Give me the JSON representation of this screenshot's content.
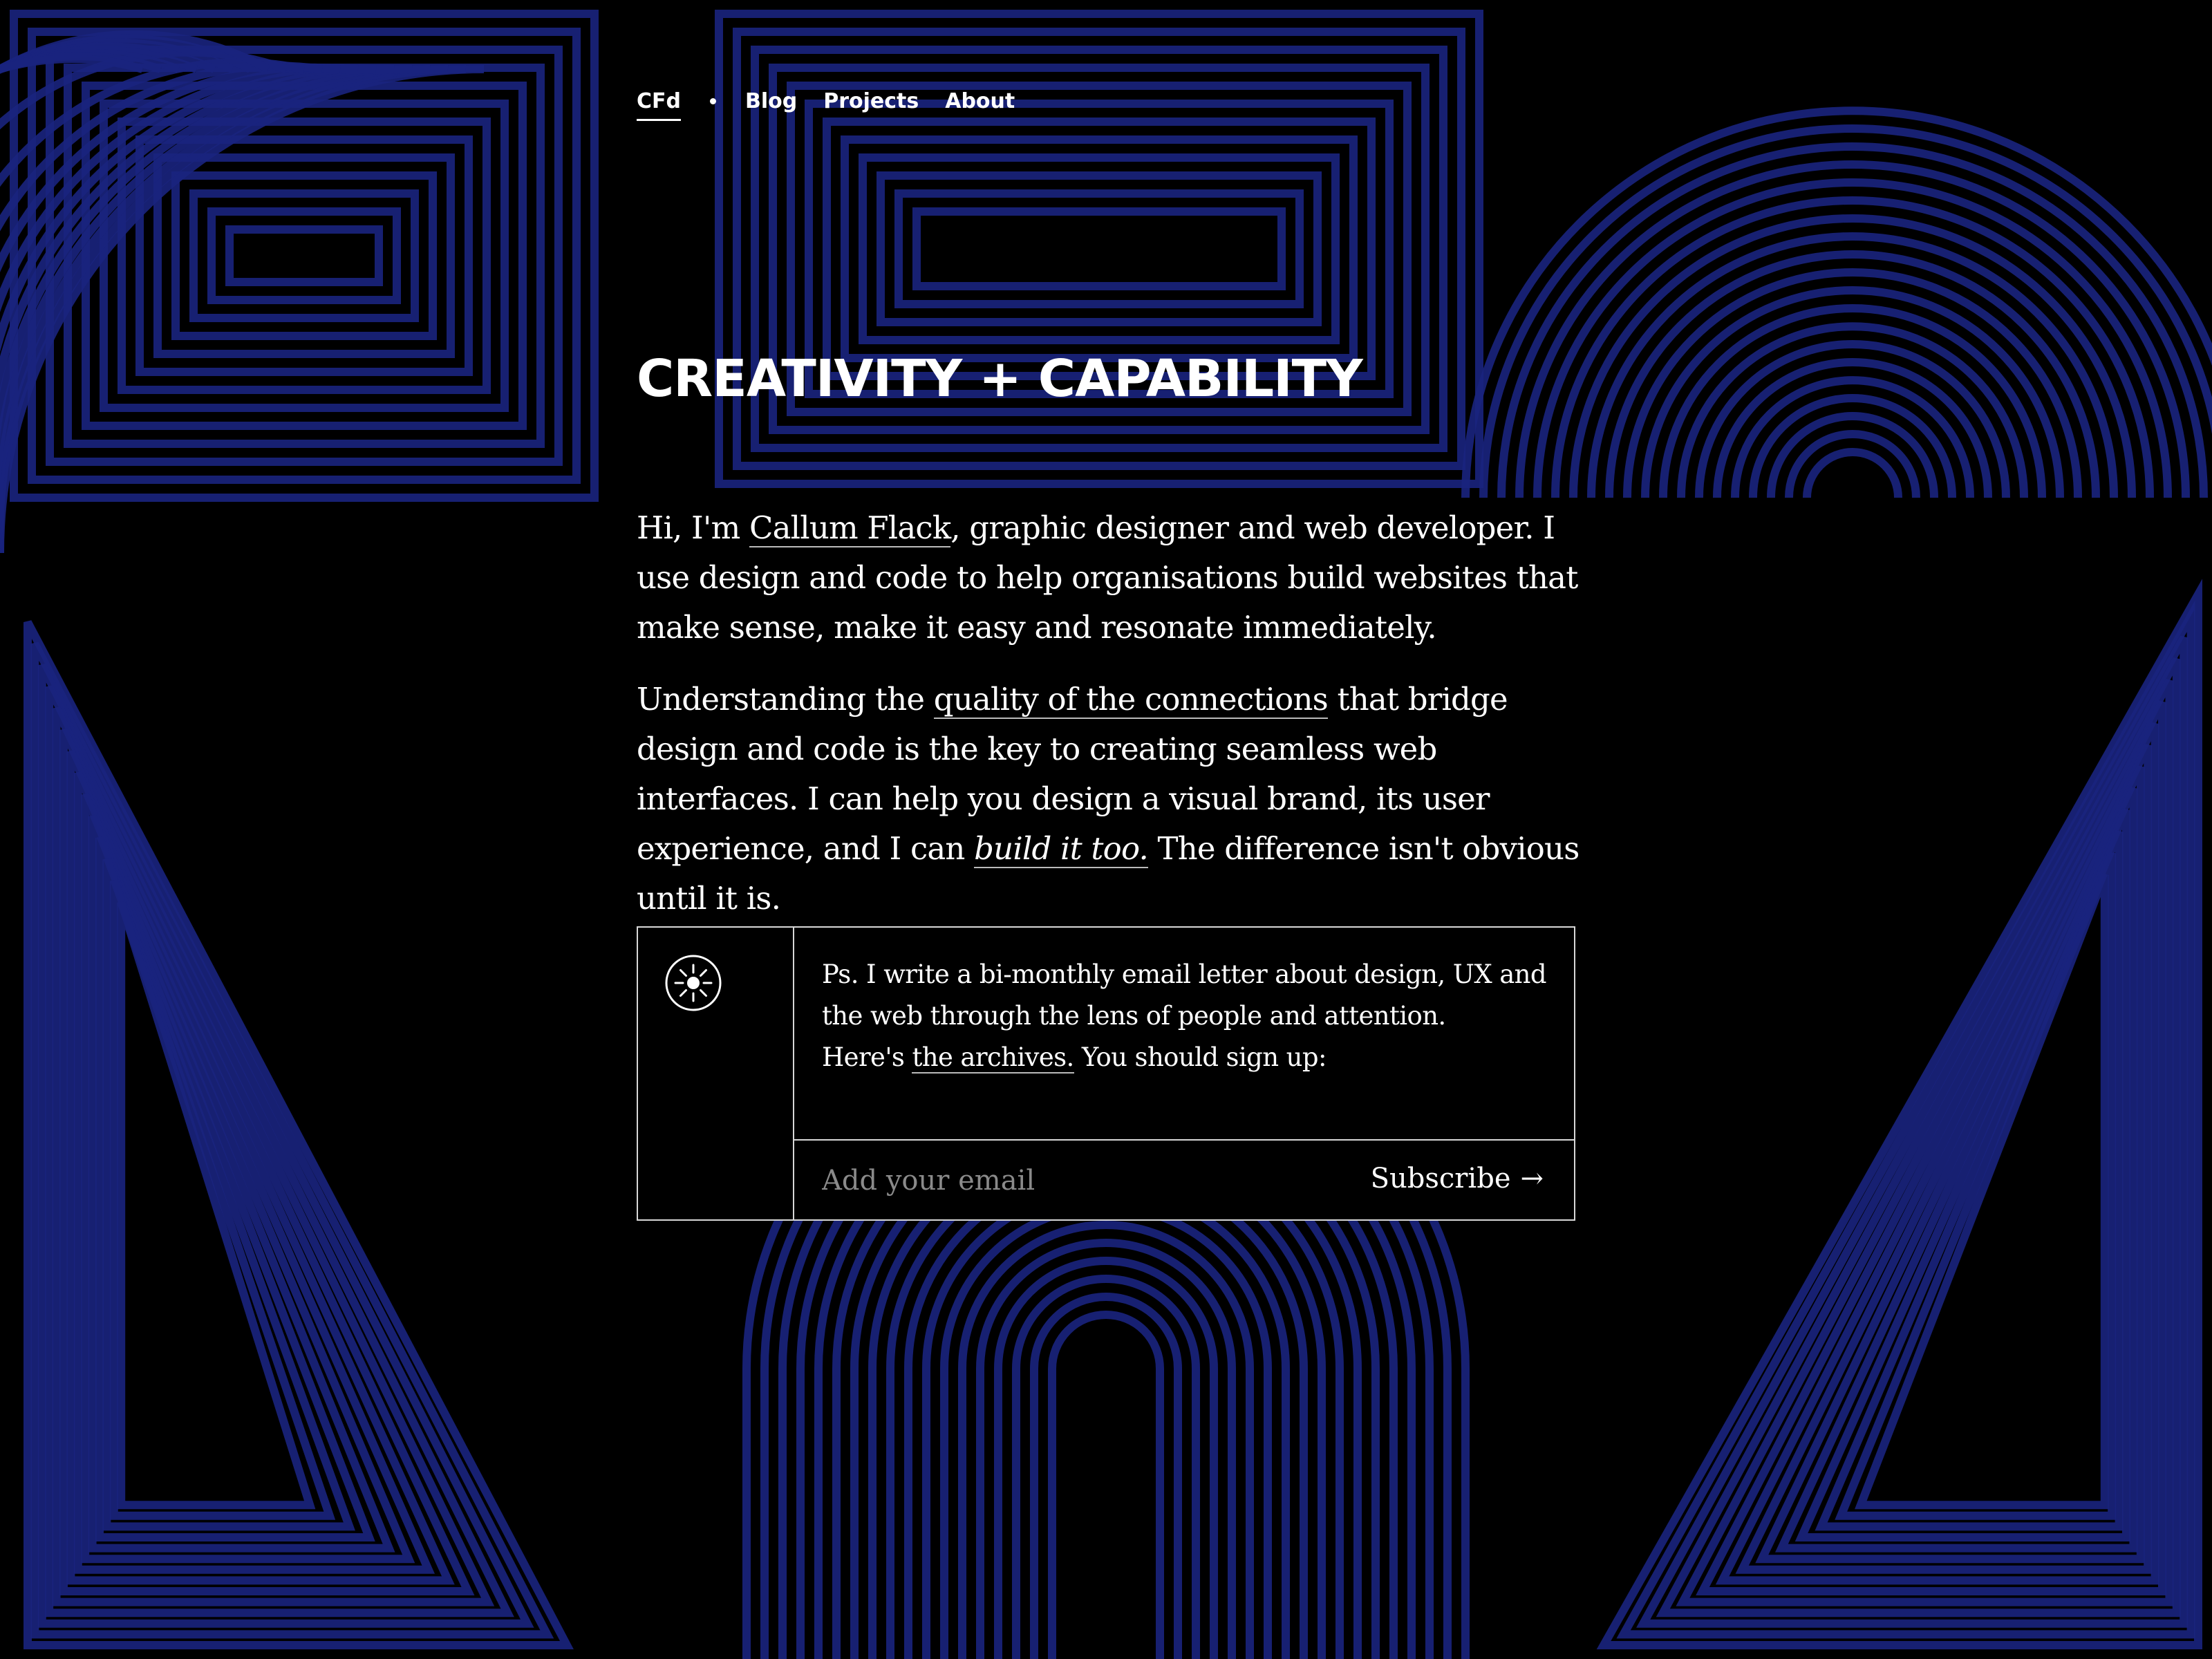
{
  "nav": {
    "home_label": "CFd",
    "items": [
      {
        "label": "Blog"
      },
      {
        "label": "Projects"
      },
      {
        "label": "About"
      }
    ]
  },
  "hero": {
    "headline": "CREATIVITY + CAPABILITY"
  },
  "intro": {
    "p1_before": "Hi, I'm ",
    "p1_link": "Callum Flack",
    "p1_after": ", graphic designer and web developer. I use design and code to help organisations build websites that make sense, make it easy and resonate immediately.",
    "p2_before": "Understanding the ",
    "p2_link": "quality of the connections",
    "p2_middle": " that bridge design and code is the key to creating seamless web interfaces. I can help you design a visual brand, its user experience, and I can ",
    "p2_em_link": "build it too.",
    "p2_after": " The difference isn't obvious until it is."
  },
  "newsletter": {
    "icon": "sun-icon",
    "line1": "Ps. I write a bi-monthly email letter about design, UX and the web through the lens of people and attention.",
    "line2_before": "Here's ",
    "line2_link": "the archives.",
    "line2_after": " You should sign up:",
    "email_placeholder": "Add your email",
    "email_value": "",
    "subscribe_label": "Subscribe",
    "subscribe_arrow": "→"
  },
  "theme": {
    "background": "#000000",
    "pattern_color": "#1a237e",
    "text": "#ffffff"
  }
}
